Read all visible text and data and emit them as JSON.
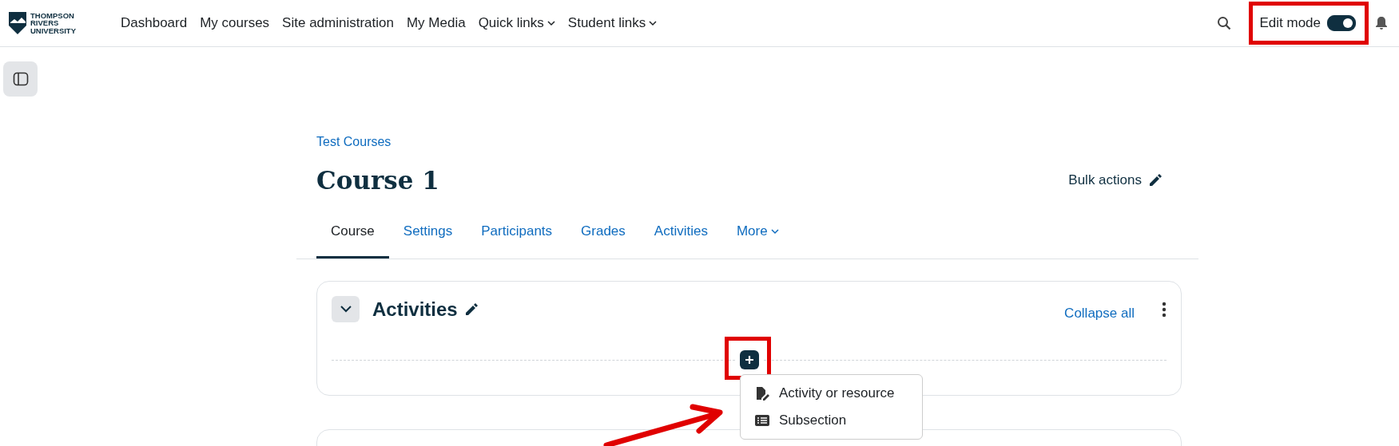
{
  "header": {
    "logo": {
      "lines": [
        "THOMPSON",
        "RIVERS",
        "UNIVERSITY"
      ]
    },
    "nav": [
      {
        "label": "Dashboard",
        "dropdown": false
      },
      {
        "label": "My courses",
        "dropdown": false
      },
      {
        "label": "Site administration",
        "dropdown": false
      },
      {
        "label": "My Media",
        "dropdown": false
      },
      {
        "label": "Quick links",
        "dropdown": true
      },
      {
        "label": "Student links",
        "dropdown": true
      }
    ],
    "edit_mode": {
      "label": "Edit mode",
      "on": true,
      "highlighted": true
    }
  },
  "breadcrumb": "Test Courses",
  "title": "Course 1",
  "bulk_actions": "Bulk actions",
  "tabs": [
    {
      "label": "Course",
      "selected": true,
      "dropdown": false
    },
    {
      "label": "Settings",
      "selected": false,
      "dropdown": false
    },
    {
      "label": "Participants",
      "selected": false,
      "dropdown": false
    },
    {
      "label": "Grades",
      "selected": false,
      "dropdown": false
    },
    {
      "label": "Activities",
      "selected": false,
      "dropdown": false
    },
    {
      "label": "More",
      "selected": false,
      "dropdown": true
    }
  ],
  "section": {
    "title": "Activities",
    "expanded": true,
    "collapse_all": "Collapse all",
    "add_button": {
      "highlighted": true
    },
    "add_menu": {
      "open": true,
      "arrow": true,
      "items": [
        {
          "kind": "activity",
          "label": "Activity or resource"
        },
        {
          "kind": "subsection",
          "label": "Subsection"
        }
      ]
    }
  }
}
